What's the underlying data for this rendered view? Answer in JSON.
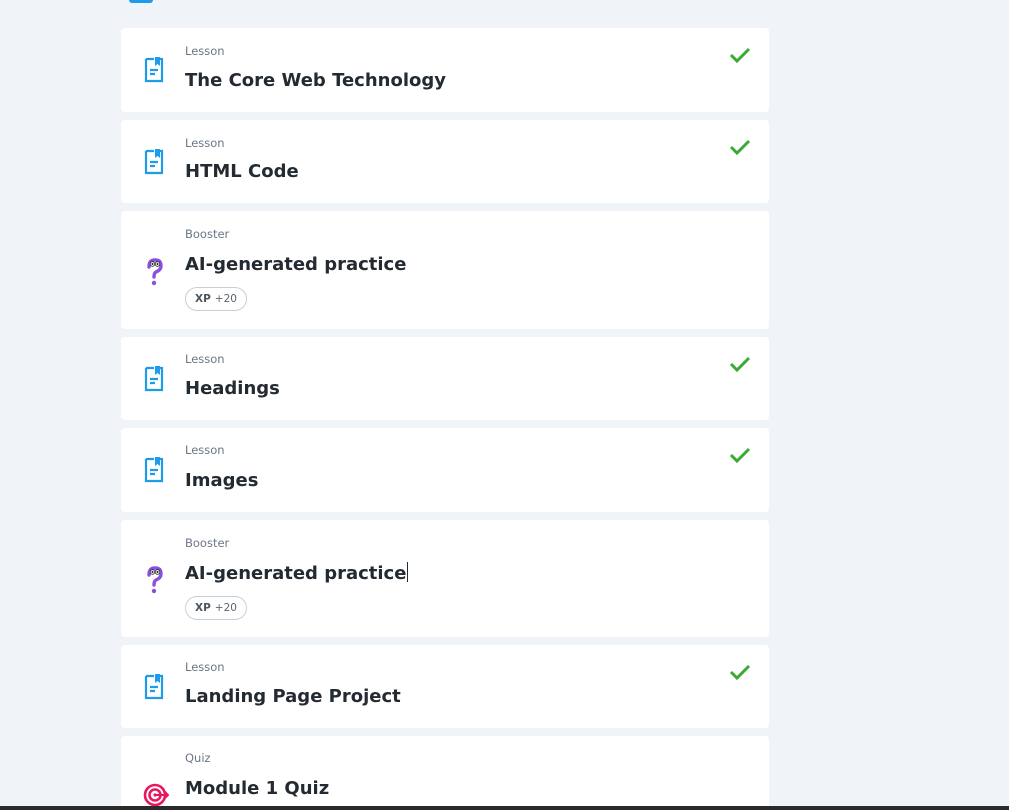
{
  "items": [
    {
      "type": "Lesson",
      "title": "The Core Web Technology",
      "completed": true
    },
    {
      "type": "Lesson",
      "title": "HTML Code",
      "completed": true
    },
    {
      "type": "Booster",
      "title": "AI-generated practice",
      "xp_label": "XP",
      "xp_value": "+20"
    },
    {
      "type": "Lesson",
      "title": "Headings",
      "completed": true
    },
    {
      "type": "Lesson",
      "title": "Images",
      "completed": true
    },
    {
      "type": "Booster",
      "title": "AI-generated practice",
      "xp_label": "XP",
      "xp_value": "+20"
    },
    {
      "type": "Lesson",
      "title": "Landing Page Project",
      "completed": true
    },
    {
      "type": "Quiz",
      "title": "Module 1 Quiz"
    }
  ],
  "colors": {
    "lesson_icon": "#1e9ce8",
    "booster_icon": "#8a4fe0",
    "quiz_icon": "#e8175d",
    "check": "#3aaa35"
  }
}
